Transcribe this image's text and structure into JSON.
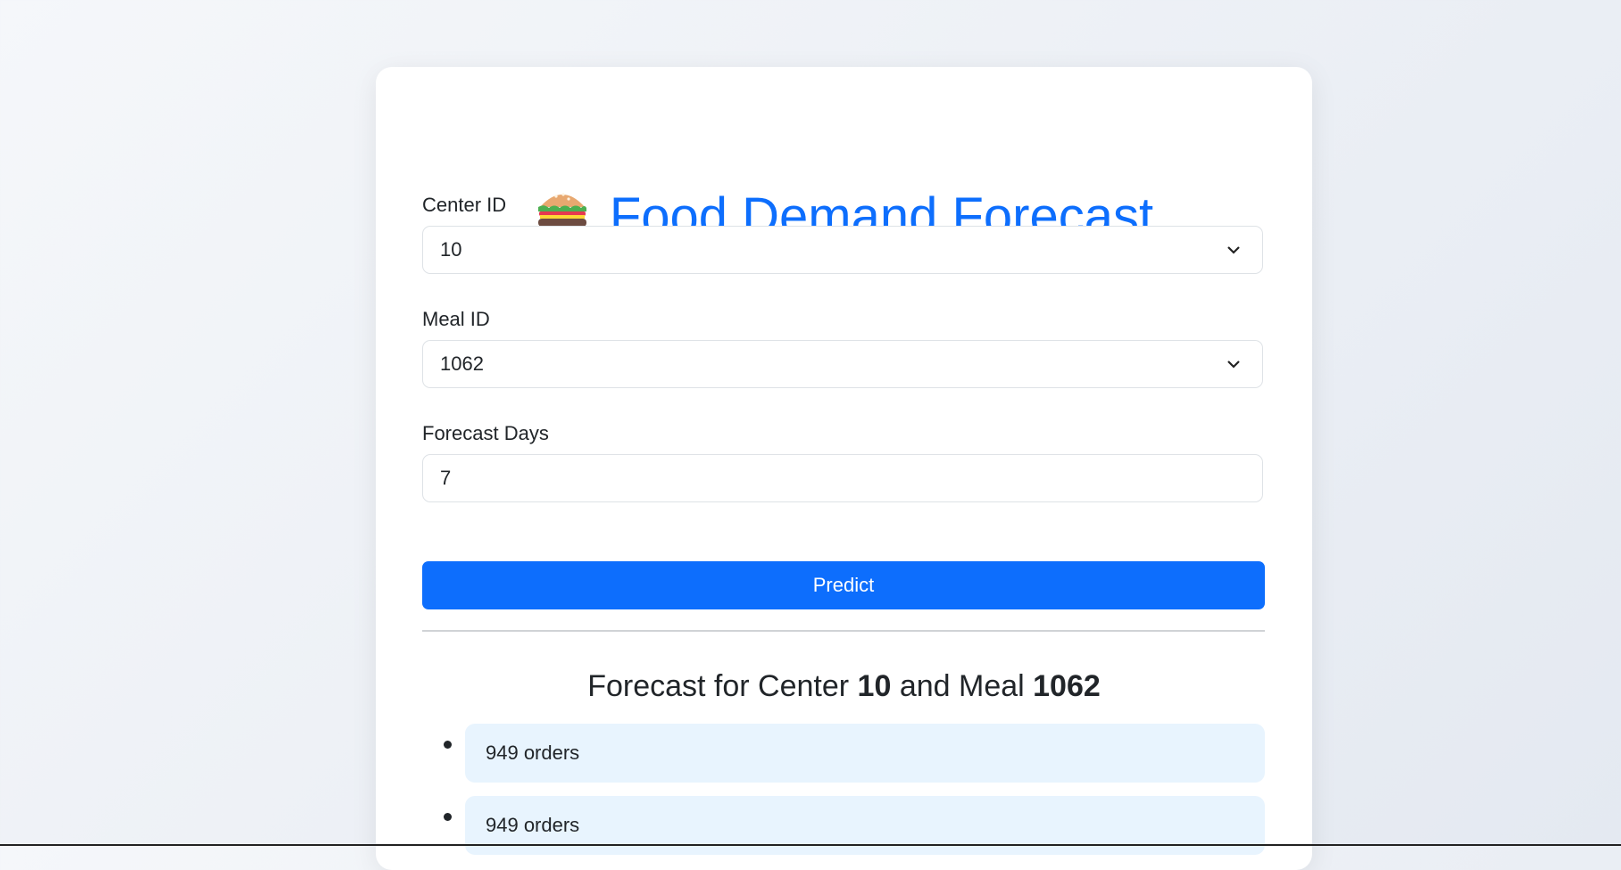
{
  "title": {
    "emoji": "🍔",
    "text": "Food Demand Forecast"
  },
  "form": {
    "center_label": "Center ID",
    "center_value": "10",
    "meal_label": "Meal ID",
    "meal_value": "1062",
    "days_label": "Forecast Days",
    "days_value": "7",
    "predict_label": "Predict"
  },
  "result": {
    "heading_prefix": "Forecast for Center ",
    "center": "10",
    "heading_mid": " and Meal ",
    "meal": "1062",
    "items": [
      "949 orders",
      "949 orders"
    ]
  },
  "colors": {
    "accent": "#0d6efd",
    "item_bg": "#e8f4fe"
  }
}
